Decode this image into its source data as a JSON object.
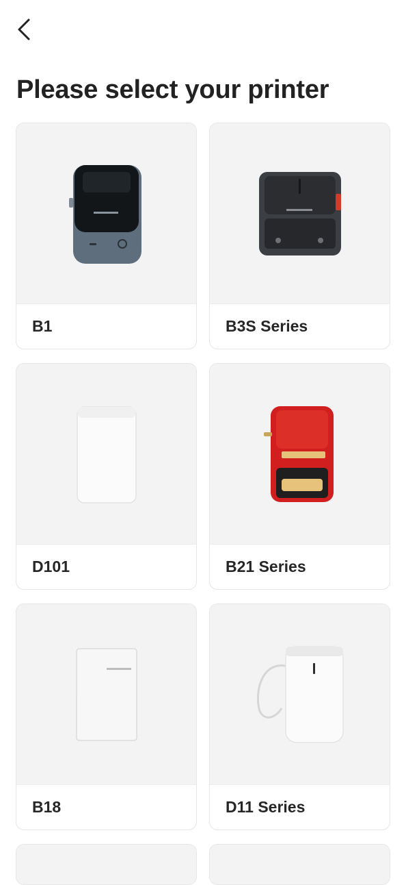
{
  "header": {
    "back_icon": "chevron-left-icon",
    "title": "Please select your printer"
  },
  "printers": [
    {
      "name": "B1",
      "image": "b1-printer-image"
    },
    {
      "name": "B3S Series",
      "image": "b3s-printer-image"
    },
    {
      "name": "D101",
      "image": "d101-printer-image"
    },
    {
      "name": "B21 Series",
      "image": "b21-printer-image"
    },
    {
      "name": "B18",
      "image": "b18-printer-image"
    },
    {
      "name": "D11 Series",
      "image": "d11-printer-image"
    }
  ],
  "colors": {
    "card_image_bg": "#f3f3f3",
    "b21_red": "#d11f1f",
    "b21_gold": "#e6c27a"
  }
}
